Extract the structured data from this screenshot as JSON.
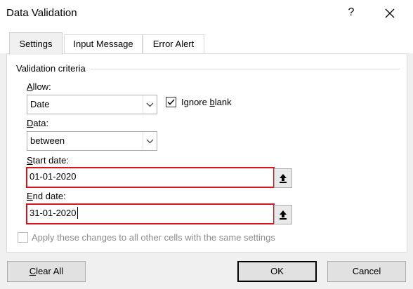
{
  "window": {
    "title": "Data Validation",
    "help_label": "?",
    "close_label": "✕"
  },
  "tabs": [
    {
      "label": "Settings",
      "active": true
    },
    {
      "label": "Input Message",
      "active": false
    },
    {
      "label": "Error Alert",
      "active": false
    }
  ],
  "criteria": {
    "group_label": "Validation criteria",
    "allow_label_key": "A",
    "allow_label_rest": "llow:",
    "allow_value": "Date",
    "ignore_blank_prefix": "Ignore ",
    "ignore_blank_key": "b",
    "ignore_blank_rest": "lank",
    "ignore_blank_checked": true,
    "data_label_key": "D",
    "data_label_rest": "ata:",
    "data_value": "between",
    "start_label_key": "S",
    "start_label_rest": "tart date:",
    "start_value": "01-01-2020",
    "end_label_key": "E",
    "end_label_rest": "nd date:",
    "end_value": "31-01-2020"
  },
  "apply_all": {
    "label": "Apply these changes to all other cells with the same settings",
    "checked": false,
    "enabled": false
  },
  "buttons": {
    "clear_key": "C",
    "clear_rest": "lear All",
    "ok": "OK",
    "cancel": "Cancel"
  },
  "icons": {
    "dropdown": "chevron-down-icon",
    "range_select": "collapse-dialog-icon",
    "checkmark": "checkmark-icon"
  }
}
